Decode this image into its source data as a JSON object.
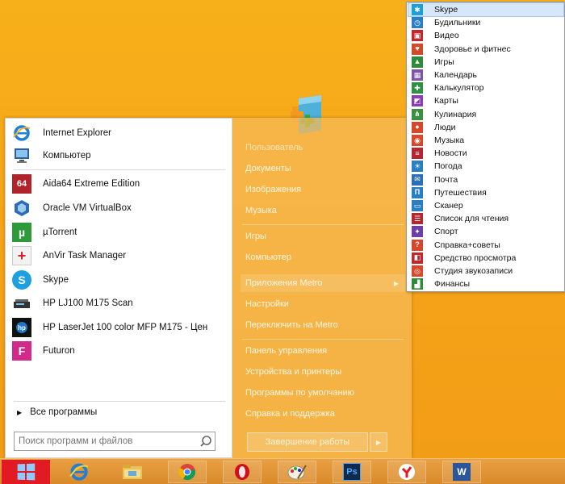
{
  "start_menu": {
    "pinned": [
      {
        "label": "Internet Explorer",
        "icon": "internet-explorer-icon"
      },
      {
        "label": "Компьютер",
        "icon": "computer-icon"
      }
    ],
    "recent": [
      {
        "label": "Aida64 Extreme Edition",
        "icon": "aida64-icon",
        "icon_text": "64"
      },
      {
        "label": "Oracle VM VirtualBox",
        "icon": "virtualbox-icon"
      },
      {
        "label": "µTorrent",
        "icon": "utorrent-icon",
        "icon_text": "µ"
      },
      {
        "label": "AnVir Task Manager",
        "icon": "anvir-icon",
        "icon_text": "+"
      },
      {
        "label": "Skype",
        "icon": "skype-icon",
        "icon_text": "S"
      },
      {
        "label": "HP LJ100 M175 Scan",
        "icon": "scanner-icon"
      },
      {
        "label": "HP LaserJet 100 color MFP M175 - Цен",
        "icon": "hp-laserjet-icon"
      },
      {
        "label": "Futuron",
        "icon": "futuron-icon",
        "icon_text": "F"
      }
    ],
    "all_programs": "Все программы",
    "search_placeholder": "Поиск программ и файлов",
    "right_links": {
      "user": "Пользователь",
      "documents": "Документы",
      "images": "Изображения",
      "music": "Музыка",
      "games": "Игры",
      "computer": "Компьютер",
      "metro_apps": "Приложения Metro",
      "settings": "Настройки",
      "switch_metro": "Переключить на Metro",
      "control_panel": "Панель управления",
      "devices": "Устройства и принтеры",
      "defaults": "Программы по умолчанию",
      "help": "Справка и поддержка"
    },
    "shutdown_label": "Завершение работы"
  },
  "metro_submenu": {
    "items": [
      {
        "label": "Skype",
        "icon": "skype-icon",
        "color": "#1e9fd8"
      },
      {
        "label": "Будильники",
        "icon": "alarm-icon",
        "color": "#2a7fc4"
      },
      {
        "label": "Видео",
        "icon": "video-icon",
        "color": "#c4262e"
      },
      {
        "label": "Здоровье и фитнес",
        "icon": "health-icon",
        "color": "#d14b2a"
      },
      {
        "label": "Игры",
        "icon": "games-icon",
        "color": "#2e8b3a"
      },
      {
        "label": "Календарь",
        "icon": "calendar-icon",
        "color": "#7b55a8"
      },
      {
        "label": "Калькулятор",
        "icon": "calculator-icon",
        "color": "#2f8f45"
      },
      {
        "label": "Карты",
        "icon": "maps-icon",
        "color": "#8a3fb0"
      },
      {
        "label": "Кулинария",
        "icon": "food-icon",
        "color": "#3a8f40"
      },
      {
        "label": "Люди",
        "icon": "people-icon",
        "color": "#d9462a"
      },
      {
        "label": "Музыка",
        "icon": "music-icon",
        "color": "#d9462a"
      },
      {
        "label": "Новости",
        "icon": "news-icon",
        "color": "#b32632"
      },
      {
        "label": "Погода",
        "icon": "weather-icon",
        "color": "#2a7fc4"
      },
      {
        "label": "Почта",
        "icon": "mail-icon",
        "color": "#2a6fb8"
      },
      {
        "label": "Путешествия",
        "icon": "travel-icon",
        "color": "#2a7fc4"
      },
      {
        "label": "Сканер",
        "icon": "scanner-icon",
        "color": "#2a7fc4"
      },
      {
        "label": "Список для чтения",
        "icon": "reading-list-icon",
        "color": "#b32632"
      },
      {
        "label": "Спорт",
        "icon": "sport-icon",
        "color": "#6b3fa8"
      },
      {
        "label": "Справка+советы",
        "icon": "help-tips-icon",
        "color": "#d9462a"
      },
      {
        "label": "Средство просмотра",
        "icon": "viewer-icon",
        "color": "#c4262e"
      },
      {
        "label": "Студия звукозаписи",
        "icon": "sound-recorder-icon",
        "color": "#d9462a"
      },
      {
        "label": "Финансы",
        "icon": "finance-icon",
        "color": "#2e8b3a"
      }
    ]
  },
  "taskbar": {
    "items": [
      {
        "name": "taskbar-internet-explorer",
        "icon": "internet-explorer-icon"
      },
      {
        "name": "taskbar-file-explorer",
        "icon": "folder-icon"
      },
      {
        "name": "taskbar-chrome",
        "icon": "chrome-icon"
      },
      {
        "name": "taskbar-opera",
        "icon": "opera-icon"
      },
      {
        "name": "taskbar-paint",
        "icon": "paint-icon"
      },
      {
        "name": "taskbar-photoshop",
        "icon": "photoshop-icon",
        "icon_text": "Ps"
      },
      {
        "name": "taskbar-yandex-browser",
        "icon": "yandex-icon"
      },
      {
        "name": "taskbar-word",
        "icon": "word-icon",
        "icon_text": "W"
      }
    ]
  }
}
